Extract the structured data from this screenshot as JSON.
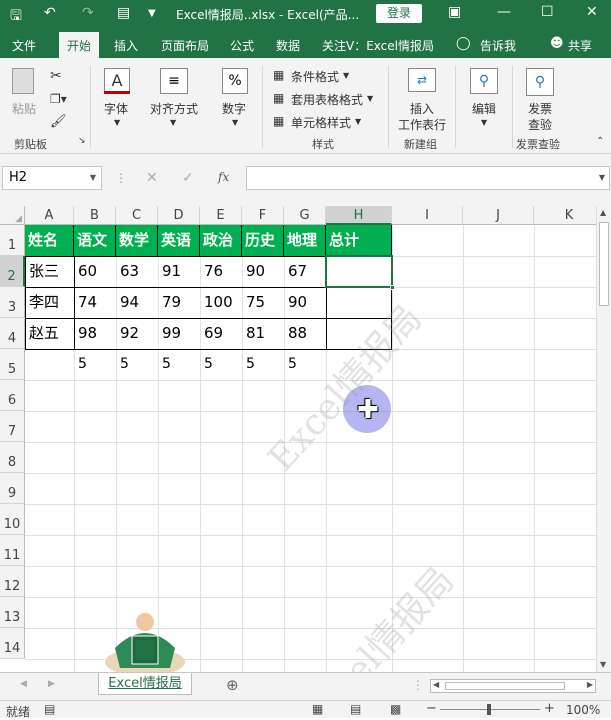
{
  "titlebar": {
    "title": "Excel情报局..xlsx  -  Excel(产品...",
    "login": "登录"
  },
  "tabs": [
    "文件",
    "开始",
    "插入",
    "页面布局",
    "公式",
    "数据",
    "关注V：Excel情报局",
    "告诉我",
    "共享"
  ],
  "ribbon": {
    "paste": "粘贴",
    "clipboard": "剪贴板",
    "font": "字体",
    "align": "对齐方式",
    "number": "数字",
    "cond_format": "条件格式",
    "table_format": "套用表格格式",
    "cell_style": "单元格样式",
    "styles": "样式",
    "insert_row": "插入",
    "insert_row2": "工作表行",
    "newgroup": "新建组",
    "edit": "编辑",
    "invoice": "发票",
    "invoice2": "查验",
    "invoice_group": "发票查验"
  },
  "formula": {
    "namebox": "H2",
    "value": ""
  },
  "columns": [
    "A",
    "B",
    "C",
    "D",
    "E",
    "F",
    "G",
    "H",
    "I",
    "J",
    "K"
  ],
  "rows": [
    "1",
    "2",
    "3",
    "4",
    "5",
    "6",
    "7",
    "8",
    "9",
    "10",
    "11",
    "12",
    "13",
    "14"
  ],
  "table": {
    "headers": [
      "姓名",
      "语文",
      "数学",
      "英语",
      "政治",
      "历史",
      "地理",
      "总计"
    ],
    "data": [
      [
        "张三",
        "60",
        "63",
        "91",
        "76",
        "90",
        "67",
        ""
      ],
      [
        "李四",
        "74",
        "94",
        "79",
        "100",
        "75",
        "90",
        ""
      ],
      [
        "赵五",
        "98",
        "92",
        "99",
        "69",
        "81",
        "88",
        ""
      ]
    ],
    "row5": [
      "",
      "5",
      "5",
      "5",
      "5",
      "5",
      "5"
    ]
  },
  "sheet": {
    "name": "Excel情报局"
  },
  "status": {
    "ready": "就绪",
    "zoom": "100%"
  },
  "watermark": "Excel情报局",
  "colors": {
    "brand": "#217346",
    "header_fill": "#00b050"
  }
}
